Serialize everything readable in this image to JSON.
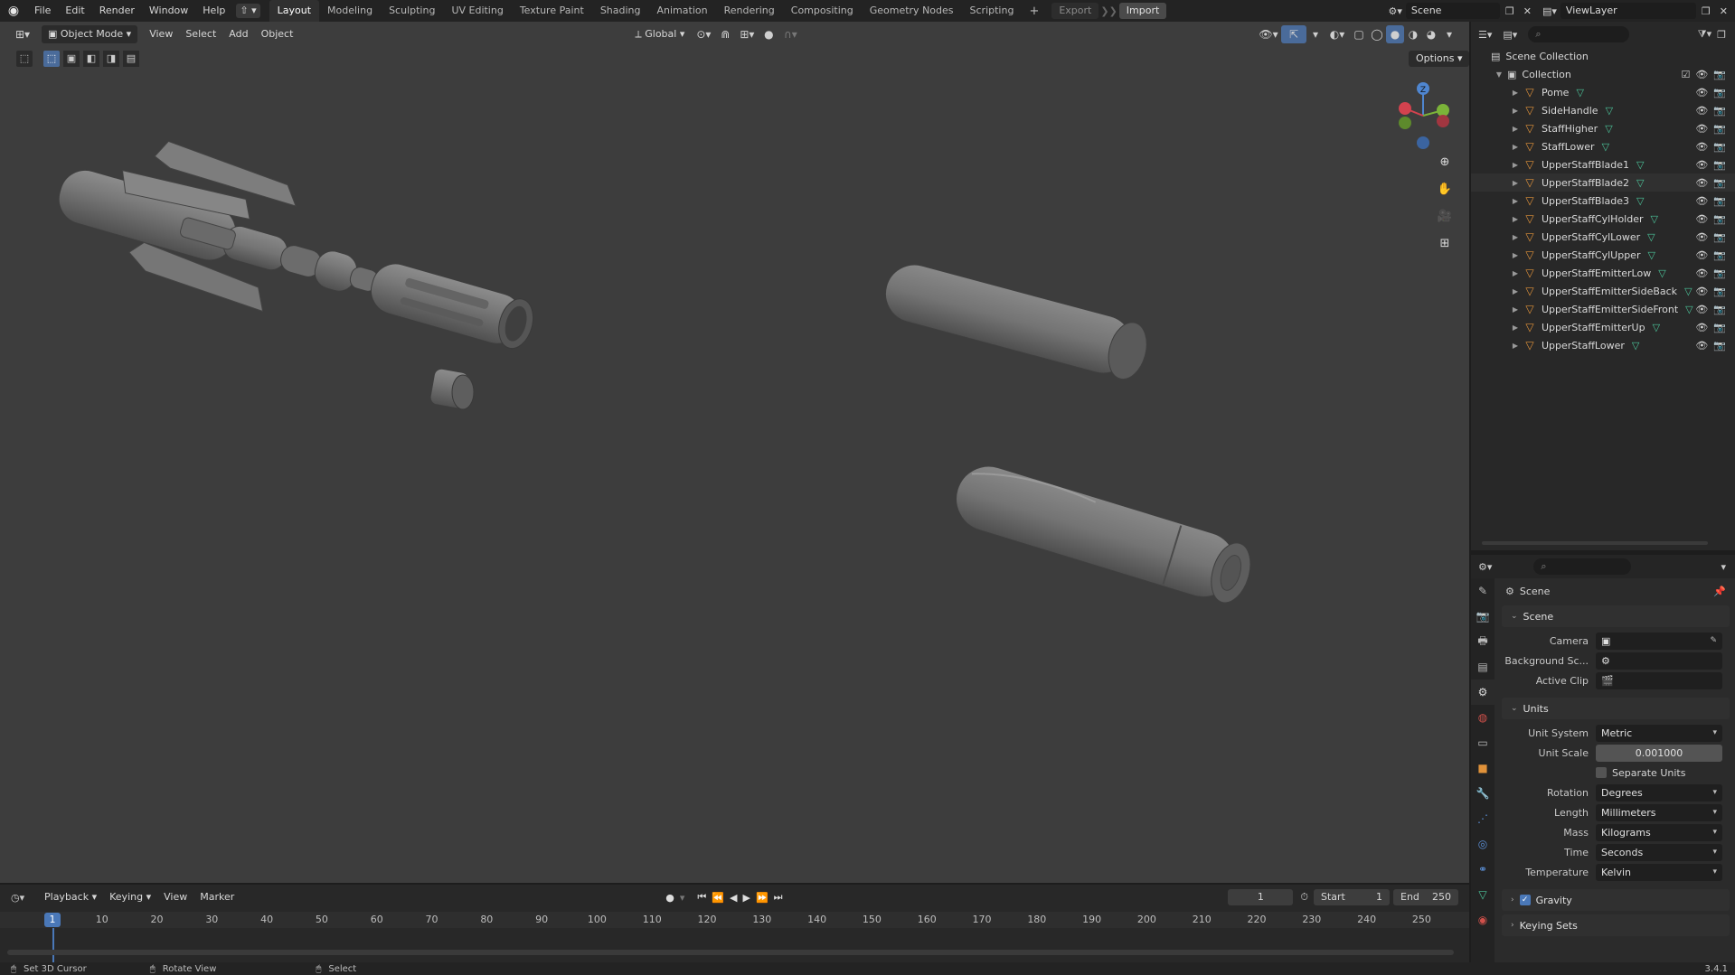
{
  "topbar": {
    "menus": [
      "File",
      "Edit",
      "Render",
      "Window",
      "Help"
    ],
    "workspaces": [
      "Layout",
      "Modeling",
      "Sculpting",
      "UV Editing",
      "Texture Paint",
      "Shading",
      "Animation",
      "Rendering",
      "Compositing",
      "Geometry Nodes",
      "Scripting"
    ],
    "export_label": "Export",
    "import_label": "Import",
    "scene_name": "Scene",
    "view_layer": "ViewLayer"
  },
  "viewport": {
    "mode": "Object Mode",
    "menus": [
      "View",
      "Select",
      "Add",
      "Object"
    ],
    "orientation": "Global",
    "options_label": "Options",
    "gizmo_axes": [
      "Z",
      "Y",
      "X"
    ]
  },
  "outliner": {
    "root": "Scene Collection",
    "collection": "Collection",
    "objects": [
      "Pome",
      "SideHandle",
      "StaffHigher",
      "StaffLower",
      "UpperStaffBlade1",
      "UpperStaffBlade2",
      "UpperStaffBlade3",
      "UpperStaffCylHolder",
      "UpperStaffCylLower",
      "UpperStaffCylUpper",
      "UpperStaffEmitterLow",
      "UpperStaffEmitterSideBack",
      "UpperStaffEmitterSideFront",
      "UpperStaffEmitterUp",
      "UpperStaffLower"
    ]
  },
  "properties": {
    "context_title": "Scene",
    "scene_section": "Scene",
    "camera_label": "Camera",
    "bg_scene_label": "Background Sc...",
    "active_clip_label": "Active Clip",
    "units_section": "Units",
    "unit_system_label": "Unit System",
    "unit_system": "Metric",
    "unit_scale_label": "Unit Scale",
    "unit_scale": "0.001000",
    "separate_units_label": "Separate Units",
    "rotation_label": "Rotation",
    "rotation": "Degrees",
    "length_label": "Length",
    "length": "Millimeters",
    "mass_label": "Mass",
    "mass": "Kilograms",
    "time_label": "Time",
    "time": "Seconds",
    "temperature_label": "Temperature",
    "temperature": "Kelvin",
    "gravity_label": "Gravity",
    "keying_sets_label": "Keying Sets"
  },
  "timeline": {
    "menus": [
      "Playback",
      "Keying",
      "View",
      "Marker"
    ],
    "current_frame": "1",
    "start_label": "Start",
    "start": "1",
    "end_label": "End",
    "end": "250",
    "ticks": [
      "10",
      "20",
      "30",
      "40",
      "50",
      "60",
      "70",
      "80",
      "90",
      "100",
      "110",
      "120",
      "130",
      "140",
      "150",
      "160",
      "170",
      "180",
      "190",
      "200",
      "210",
      "220",
      "230",
      "240",
      "250"
    ]
  },
  "statusbar": {
    "hint1": "Set 3D Cursor",
    "hint2": "Rotate View",
    "hint3": "Select",
    "version": "3.4.1"
  }
}
